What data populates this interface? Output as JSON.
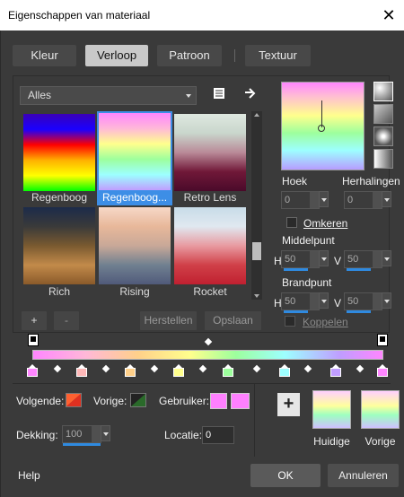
{
  "window": {
    "title": "Eigenschappen van materiaal",
    "close_glyph": "✕"
  },
  "tabs": [
    "Kleur",
    "Verloop",
    "Patroon",
    "Textuur"
  ],
  "filter": {
    "value": "Alles"
  },
  "gradients": [
    {
      "label": "Regenboog",
      "stops": [
        "#3a00b8",
        "#1a00ff",
        "#ff0000",
        "#ffb000",
        "#ffff00",
        "#00ff00"
      ]
    },
    {
      "label": "Regenboog...",
      "stops": [
        "#ff86ff",
        "#ffb8d8",
        "#ffff8d",
        "#9dff9d",
        "#9dffff",
        "#c09dff"
      ]
    },
    {
      "label": "Retro Lens",
      "stops": [
        "#dfe8e0",
        "#c9d6cc",
        "#b98a98",
        "#701838",
        "#4a0a2a"
      ]
    },
    {
      "label": "Rich",
      "stops": [
        "#1c2b4a",
        "#3a3a3a",
        "#7a5a30",
        "#c28a4a",
        "#8a5a2a"
      ]
    },
    {
      "label": "Rising",
      "stops": [
        "#f6d8c8",
        "#e8b89a",
        "#c8a898",
        "#708090",
        "#505a7a"
      ]
    },
    {
      "label": "Rocket",
      "stops": [
        "#c8dce8",
        "#e0e8f0",
        "#e89aa0",
        "#d04048",
        "#c02030"
      ]
    }
  ],
  "buttons": {
    "add": "+",
    "remove": "-",
    "restore": "Herstellen",
    "save": "Opslaan",
    "ok": "OK",
    "cancel": "Annuleren",
    "help": "Help"
  },
  "angle": {
    "label": "Hoek",
    "value": "0"
  },
  "repeats": {
    "label": "Herhalingen",
    "value": "0"
  },
  "invert": {
    "label": "Omkeren"
  },
  "midpoint": {
    "label": "Middelpunt",
    "h_label": "H",
    "h": "50",
    "v_label": "V",
    "v": "50"
  },
  "focus": {
    "label": "Brandpunt",
    "h_label": "H",
    "h": "50",
    "v_label": "V",
    "v": "50"
  },
  "link": {
    "label": "Koppelen"
  },
  "colors": {
    "next_label": "Volgende:",
    "prev_label": "Vorige:",
    "user_label": "Gebruiker:",
    "next_color": "#e03020",
    "prev_color": "#2a6a2a",
    "user_color": "#ff80ff"
  },
  "opacity": {
    "label": "Dekking:",
    "value": "100"
  },
  "location": {
    "label": "Locatie:",
    "value": "0"
  },
  "thumbs": {
    "current_label": "Huidige",
    "previous_label": "Vorige"
  },
  "stop_colors": [
    "#ff86ff",
    "#ffb8b8",
    "#ffd08a",
    "#ffff8d",
    "#9dff9d",
    "#9dffff",
    "#c09dff",
    "#ff86ff"
  ]
}
